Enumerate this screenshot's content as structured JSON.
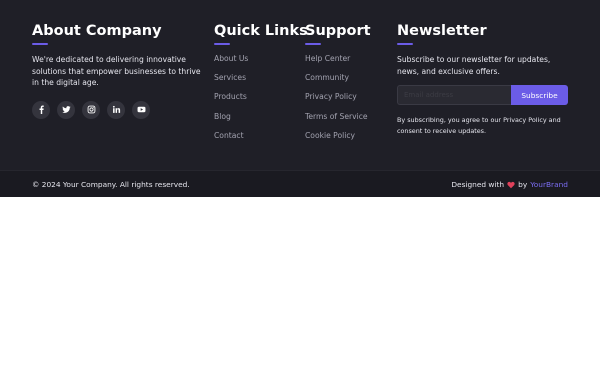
{
  "about": {
    "title": "About Company",
    "description": "We're dedicated to delivering innovative solutions that empower businesses to thrive in the digital age.",
    "socials": [
      "facebook-icon",
      "twitter-icon",
      "instagram-icon",
      "linkedin-icon",
      "youtube-icon"
    ]
  },
  "quick_links": {
    "title": "Quick Links",
    "items": [
      "About Us",
      "Services",
      "Products",
      "Blog",
      "Contact"
    ]
  },
  "support": {
    "title": "Support",
    "items": [
      "Help Center",
      "Community",
      "Privacy Policy",
      "Terms of Service",
      "Cookie Policy"
    ]
  },
  "newsletter": {
    "title": "Newsletter",
    "description": "Subscribe to our newsletter for updates, news, and exclusive offers.",
    "email_placeholder": "Email address",
    "email_value": "",
    "subscribe_label": "Subscribe",
    "consent": "By subscribing, you agree to our Privacy Policy and consent to receive updates."
  },
  "bottom": {
    "copyright": "© 2024 Your Company. All rights reserved.",
    "designed_prefix": "Designed with",
    "designed_by": "by",
    "brand": "YourBrand"
  },
  "colors": {
    "background": "#1f1f27",
    "bottom_bar": "#1a1a21",
    "accent": "#6b5ce7",
    "heart": "#e0415b",
    "link": "#a3a3b0"
  }
}
